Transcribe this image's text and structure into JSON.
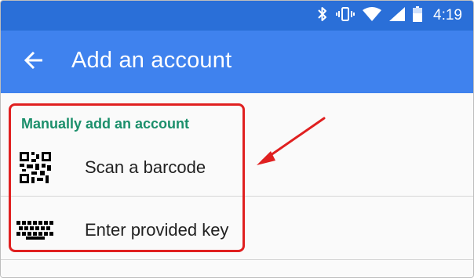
{
  "status_bar": {
    "time": "4:19",
    "icons": [
      "bluetooth-icon",
      "vibrate-icon",
      "wifi-icon",
      "signal-icon",
      "battery-icon"
    ]
  },
  "app_bar": {
    "title": "Add an account",
    "back_icon": "arrow-left-icon"
  },
  "section": {
    "header": "Manually add an account",
    "items": [
      {
        "label": "Scan a barcode",
        "icon": "qr-code-icon"
      },
      {
        "label": "Enter provided key",
        "icon": "keyboard-icon"
      }
    ]
  },
  "colors": {
    "status_bar": "#2a6fd8",
    "app_bar": "#3f82ee",
    "section_header": "#1b8f6b",
    "annotation": "#e02020"
  }
}
